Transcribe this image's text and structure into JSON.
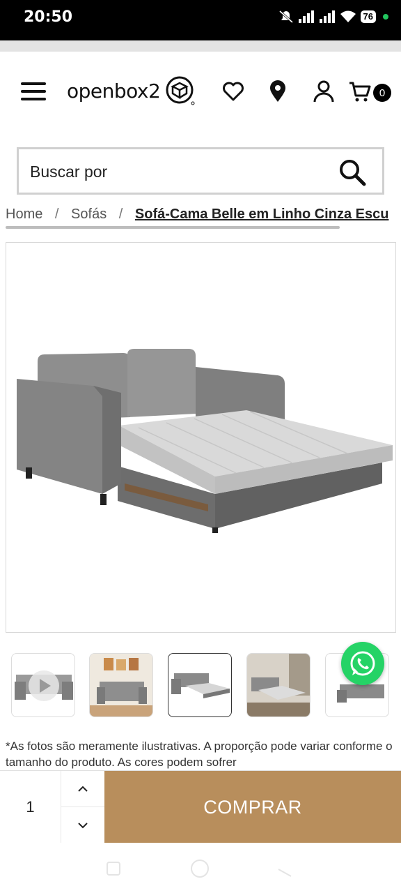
{
  "status_bar": {
    "time": "20:50",
    "battery": "76"
  },
  "header": {
    "logo_text": "openbox2",
    "cart_count": "0",
    "icons": [
      "menu-icon",
      "logo-box-icon",
      "heart-icon",
      "location-pin-icon",
      "user-icon",
      "cart-icon"
    ]
  },
  "search": {
    "placeholder": "Buscar por",
    "icon": "search-icon"
  },
  "breadcrumb": {
    "items": [
      "Home",
      "Sofás",
      "Sofá-Cama Belle em Linho Cinza Escu"
    ],
    "separator": "/"
  },
  "gallery": {
    "thumbnails": [
      {
        "kind": "video",
        "icon": "play-icon"
      },
      {
        "kind": "photo"
      },
      {
        "kind": "photo",
        "selected": true
      },
      {
        "kind": "photo"
      },
      {
        "kind": "photo"
      }
    ]
  },
  "disclaimer": "*As fotos são meramente ilustrativas. A proporção pode variar conforme o tamanho do produto. As cores podem sofrer",
  "purchase": {
    "quantity": "1",
    "buy_label": "COMPRAR"
  },
  "colors": {
    "buy_button": "#b88e5c",
    "whatsapp": "#25d366",
    "sofa": "#8a8a8a"
  }
}
